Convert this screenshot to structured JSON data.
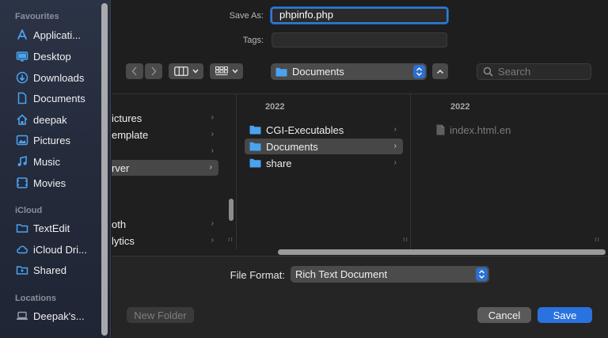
{
  "sidebar": {
    "favourites_header": "Favourites",
    "favourites": [
      {
        "label": "Applicati...",
        "icon": "applications-icon"
      },
      {
        "label": "Desktop",
        "icon": "desktop-icon"
      },
      {
        "label": "Downloads",
        "icon": "downloads-icon"
      },
      {
        "label": "Documents",
        "icon": "document-icon"
      },
      {
        "label": "deepak",
        "icon": "home-icon"
      },
      {
        "label": "Pictures",
        "icon": "pictures-icon"
      },
      {
        "label": "Music",
        "icon": "music-icon"
      },
      {
        "label": "Movies",
        "icon": "movies-icon"
      }
    ],
    "icloud_header": "iCloud",
    "icloud": [
      {
        "label": "TextEdit",
        "icon": "folder-icon"
      },
      {
        "label": "iCloud Dri...",
        "icon": "cloud-icon"
      },
      {
        "label": "Shared",
        "icon": "shared-folder-icon"
      }
    ],
    "locations_header": "Locations",
    "locations": [
      {
        "label": "Deepak's...",
        "icon": "laptop-icon"
      }
    ]
  },
  "form": {
    "save_as_label": "Save As:",
    "save_as_value": "phpinfo.php",
    "tags_label": "Tags:",
    "tags_value": ""
  },
  "toolbar": {
    "location": "Documents",
    "search_placeholder": "Search"
  },
  "browser": {
    "col1": {
      "rows": [
        "ictures",
        "emplate",
        "",
        "rver",
        "",
        "",
        "oth",
        "lytics"
      ],
      "selected_index": 3
    },
    "col2": {
      "header": "2022",
      "rows": [
        "CGI-Executables",
        "Documents",
        "share"
      ],
      "selected_index": 1
    },
    "col3": {
      "header": "2022",
      "rows": [
        "index.html.en"
      ]
    }
  },
  "bottom": {
    "file_format_label": "File Format:",
    "file_format_value": "Rich Text Document",
    "new_folder": "New Folder",
    "cancel": "Cancel",
    "save": "Save"
  },
  "colors": {
    "accent": "#2a72df",
    "folder": "#4aa3f0"
  }
}
